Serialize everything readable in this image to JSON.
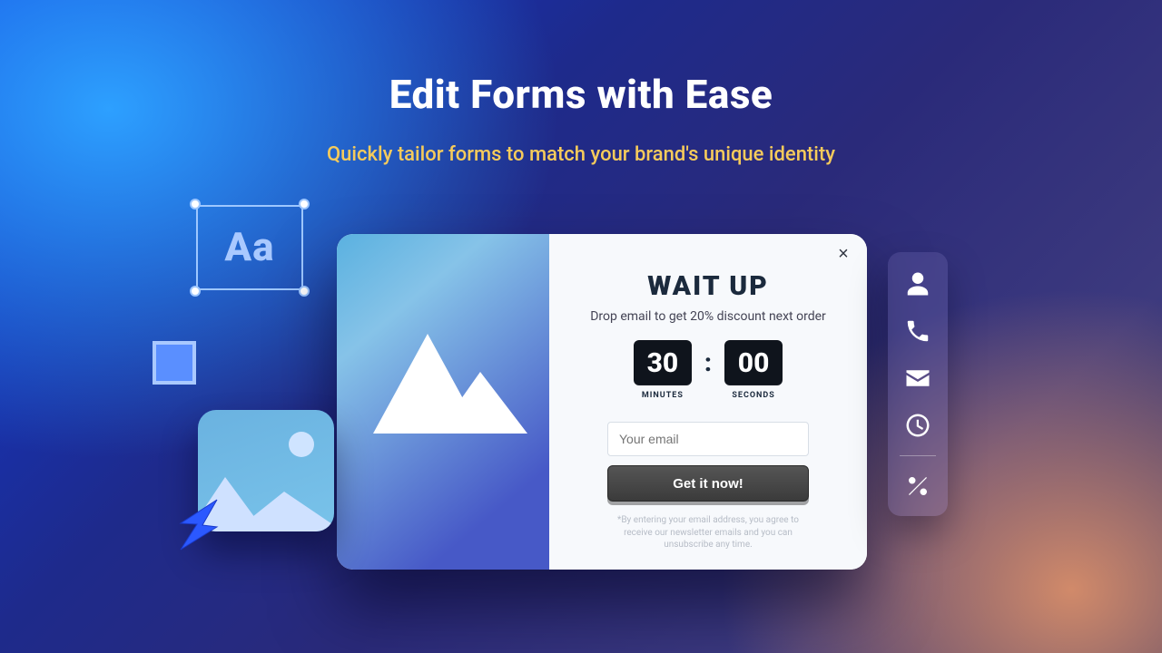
{
  "hero": {
    "title": "Edit Forms with Ease",
    "subtitle": "Quickly tailor forms to match your brand's unique identity"
  },
  "decor": {
    "aa_label": "Aa",
    "swatch_color": "#5a8fff"
  },
  "popup": {
    "title": "WAIT UP",
    "subtitle": "Drop email to get 20% discount next order",
    "counter": {
      "minutes_value": "30",
      "minutes_label": "MINUTES",
      "seconds_value": "00",
      "seconds_label": "SECONDS",
      "separator": ":"
    },
    "email_placeholder": "Your email",
    "cta_label": "Get it now!",
    "fine_print": "*By entering your email address, you agree to receive our newsletter emails and you can unsubscribe any time.",
    "close_label": "×"
  },
  "toolbar": {
    "items": [
      {
        "name": "user-icon"
      },
      {
        "name": "phone-icon"
      },
      {
        "name": "mail-icon"
      },
      {
        "name": "clock-icon"
      },
      {
        "name": "percent-icon"
      }
    ]
  }
}
